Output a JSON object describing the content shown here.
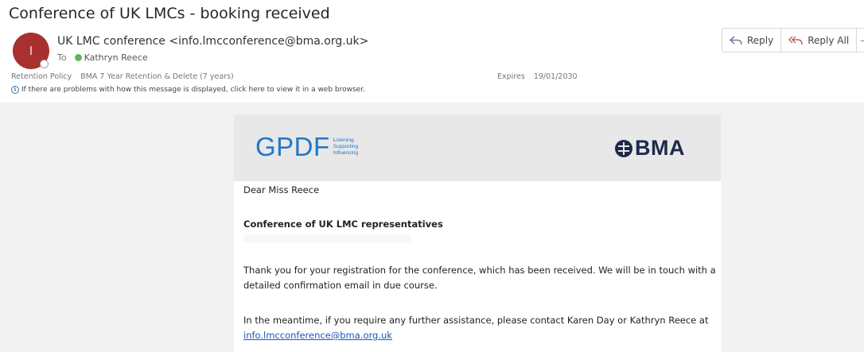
{
  "subject": "Conference of UK LMCs - booking received",
  "sender": {
    "avatar_initial": "I",
    "display": "UK LMC conference <info.lmcconference@bma.org.uk>"
  },
  "recipients": {
    "to_label": "To",
    "name": "Kathryn Reece"
  },
  "retention": {
    "label": "Retention Policy",
    "value": "BMA 7 Year Retention & Delete (7 years)"
  },
  "expires": {
    "label": "Expires",
    "value": "19/01/2030"
  },
  "info_bar": {
    "text": "If there are problems with how this message is displayed, click here to view it in a web browser."
  },
  "actions": {
    "reply": "Reply",
    "reply_all": "Reply All"
  },
  "banner": {
    "gpdf": "GPDF",
    "gpdf_tagline": [
      "Listening",
      "Supporting",
      "Influencing"
    ],
    "bma": "BMA"
  },
  "message": {
    "greeting": "Dear Miss Reece",
    "heading": "Conference of UK LMC representatives",
    "para1_line1": "Thank you for your registration for the conference, which has been received.  We will be in touch with a",
    "para1_line2": "detailed confirmation email in due course.",
    "para2_line1": "In the meantime, if you require any further assistance, please contact Karen Day or Kathryn Reece at",
    "contact_email": "info.lmcconference@bma.org.uk"
  },
  "colors": {
    "avatar": "#a8312f",
    "presence": "#5cb85c",
    "gpdf_blue": "#1f78c8",
    "bma_navy": "#1d2a4d",
    "link": "#1a56b8"
  }
}
